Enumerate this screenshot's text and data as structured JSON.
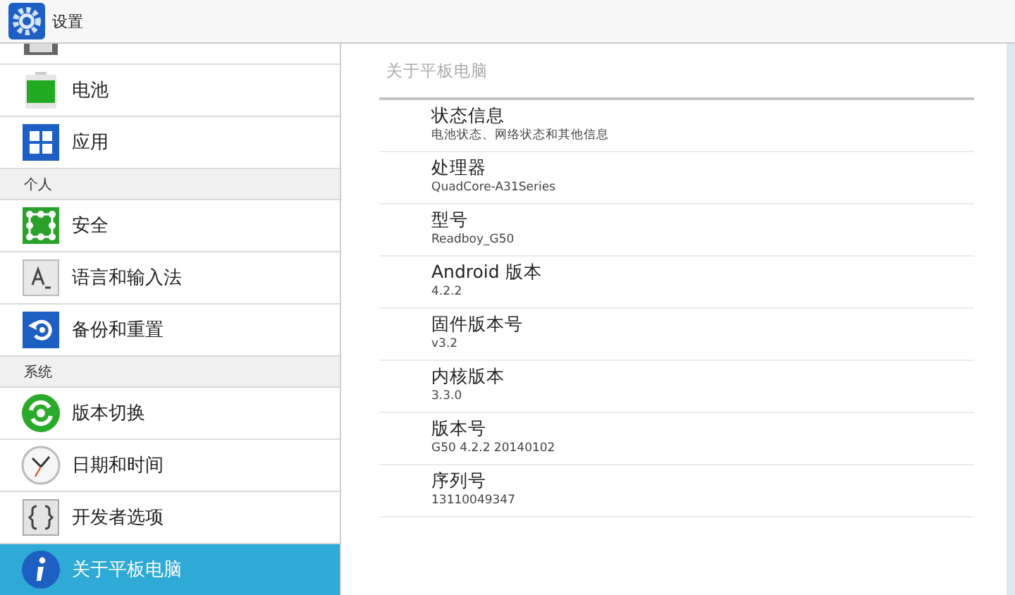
{
  "app_bar": {
    "title": "设置"
  },
  "sidebar": [
    {
      "kind": "item",
      "selected": false
    },
    {
      "kind": "item",
      "label": "电池",
      "selected": false
    },
    {
      "kind": "item",
      "label": "应用",
      "selected": false
    },
    {
      "kind": "header",
      "label": "个人"
    },
    {
      "kind": "item",
      "label": "安全",
      "selected": false
    },
    {
      "kind": "item",
      "label": "语言和输入法",
      "selected": false
    },
    {
      "kind": "item",
      "label": "备份和重置",
      "selected": false
    },
    {
      "kind": "header",
      "label": "系统"
    },
    {
      "kind": "item",
      "label": "版本切换",
      "selected": false
    },
    {
      "kind": "item",
      "label": "日期和时间",
      "selected": false
    },
    {
      "kind": "item",
      "label": "开发者选项",
      "selected": false
    },
    {
      "kind": "item",
      "label": "关于平板电脑",
      "selected": true
    }
  ],
  "detail": {
    "title": "关于平板电脑",
    "rows": [
      {
        "title": "状态信息",
        "summary": "电池状态、网络状态和其他信息"
      },
      {
        "title": "处理器",
        "summary": "QuadCore-A31Series"
      },
      {
        "title": "型号",
        "summary": "Readboy_G50"
      },
      {
        "title": "Android 版本",
        "summary": "4.2.2"
      },
      {
        "title": "固件版本号",
        "summary": "v3.2"
      },
      {
        "title": "内核版本",
        "summary": "3.3.0"
      },
      {
        "title": "版本号",
        "summary": "G50 4.2.2 20140102"
      },
      {
        "title": "序列号",
        "summary": "13110049347"
      }
    ]
  }
}
